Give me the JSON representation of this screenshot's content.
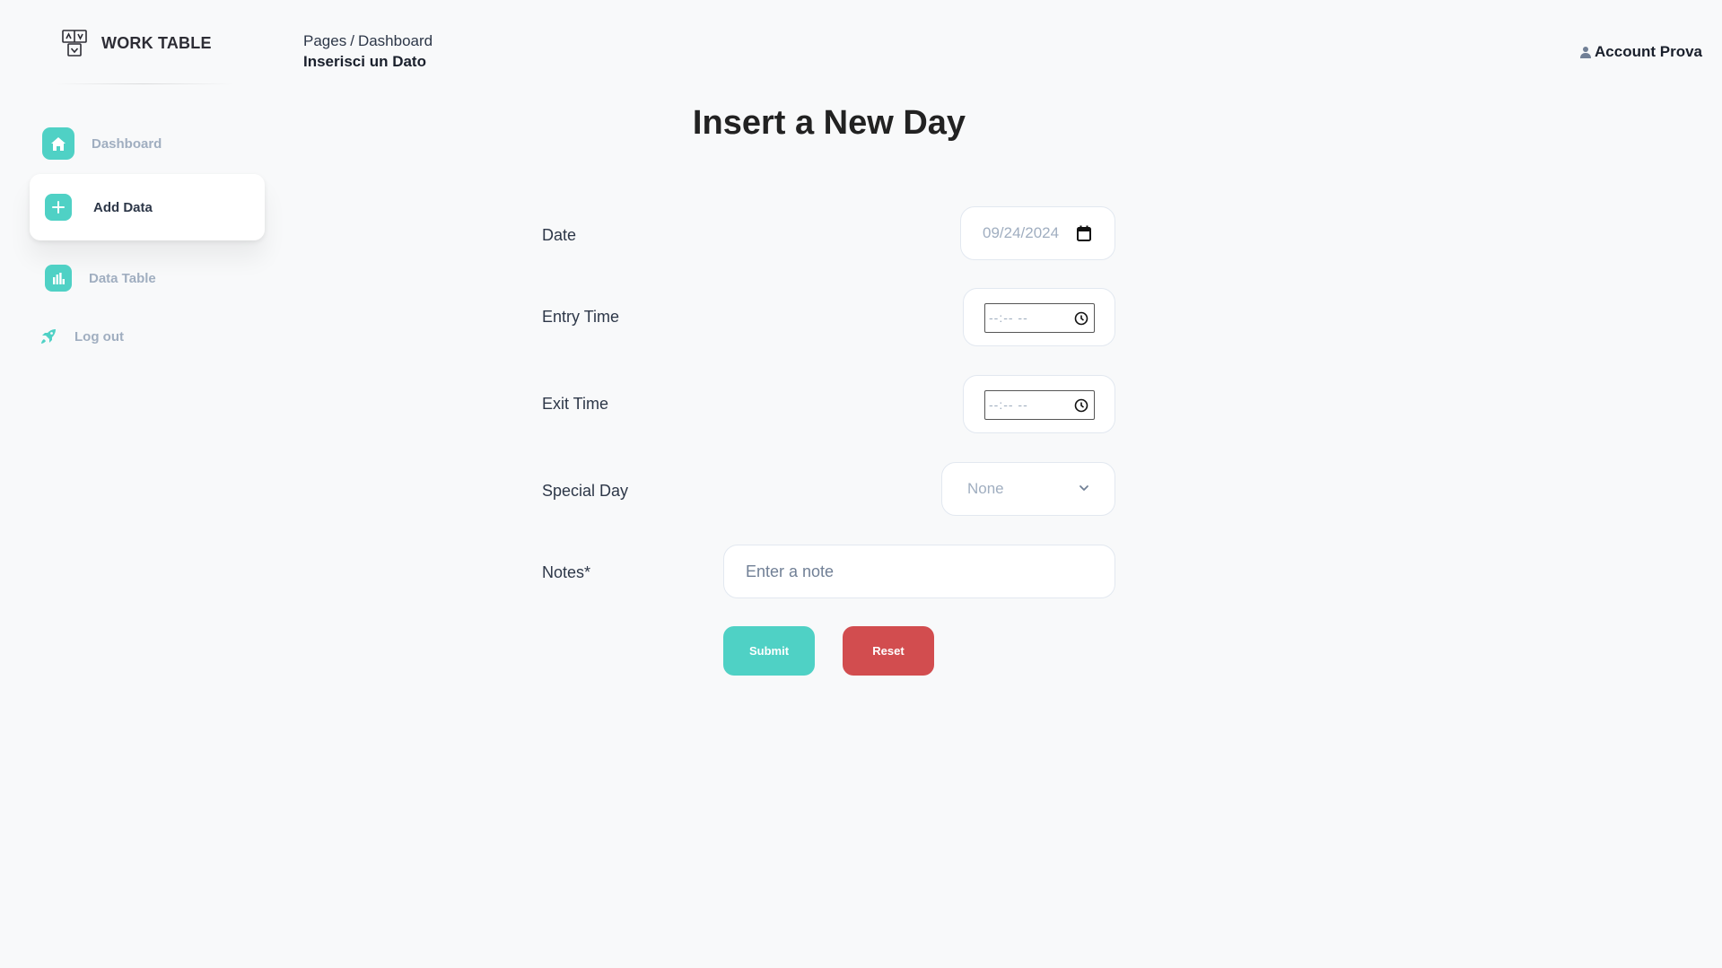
{
  "brand": {
    "name": "WORK TABLE"
  },
  "sidebar": {
    "items": [
      {
        "label": "Dashboard",
        "icon": "home-icon"
      },
      {
        "label": "Add Data",
        "icon": "plus-circle-icon",
        "active": true
      },
      {
        "label": "Data Table",
        "icon": "bar-chart-icon"
      }
    ],
    "logout": {
      "label": "Log out",
      "icon": "rocket-icon"
    }
  },
  "header": {
    "breadcrumb_root": "Pages",
    "breadcrumb_separator": "/",
    "breadcrumb_current": "Dashboard",
    "page_subtitle": "Inserisci un Dato",
    "account_label": "Account Prova",
    "account_icon": "user-icon"
  },
  "form": {
    "title": "Insert a New Day",
    "date": {
      "label": "Date",
      "value": "09/24/2024"
    },
    "entry_time": {
      "label": "Entry Time",
      "placeholder": "--:-- --"
    },
    "exit_time": {
      "label": "Exit Time",
      "placeholder": "--:-- --"
    },
    "special_day": {
      "label": "Special Day",
      "value": "None"
    },
    "notes": {
      "label": "Notes*",
      "placeholder": "Enter a note"
    },
    "submit_label": "Submit",
    "reset_label": "Reset"
  },
  "colors": {
    "accent": "#4fd1c5",
    "danger": "#d24d4f",
    "background": "#f8f9fa"
  }
}
